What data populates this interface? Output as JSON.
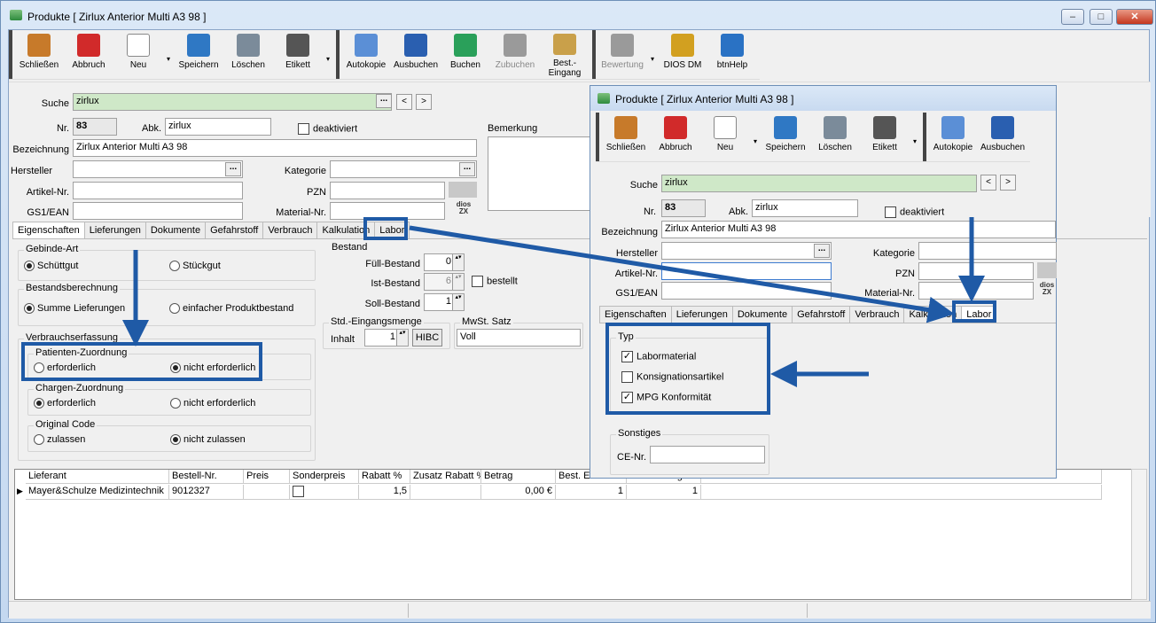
{
  "window": {
    "title": "Produkte [ Zirlux Anterior Multi A3 98 ]",
    "min": "–",
    "max": "□",
    "close": "✕"
  },
  "toolbar": {
    "groups": [
      [
        {
          "label": "Schließen",
          "icon": "door-exit-icon",
          "color": "#c77a2a"
        },
        {
          "label": "Abbruch",
          "icon": "cancel-icon",
          "color": "#d12a2a"
        },
        {
          "label": "Neu",
          "icon": "new-document-icon",
          "color": "#ffffff"
        },
        {
          "label": "Speichern",
          "icon": "save-disk-icon",
          "color": "#2f78c4"
        },
        {
          "label": "Löschen",
          "icon": "trash-icon",
          "color": "#7b8b9a"
        },
        {
          "label": "Etikett",
          "icon": "barcode-printer-icon",
          "color": "#555555"
        }
      ],
      [
        {
          "label": "Autokopie",
          "icon": "copy-icon",
          "color": "#5b8fd6"
        },
        {
          "label": "Ausbuchen",
          "icon": "book-out-icon",
          "color": "#2a5fb0"
        },
        {
          "label": "Buchen",
          "icon": "book-in-icon",
          "color": "#2aa05a"
        },
        {
          "label": "Zubuchen",
          "icon": "book-add-icon",
          "color": "#9a9a9a"
        },
        {
          "label": "Best.-Eingang",
          "icon": "package-icon",
          "color": "#c9a04a"
        }
      ],
      [
        {
          "label": "Bewertung",
          "icon": "rating-chart-icon",
          "color": "#9a9a9a"
        },
        {
          "label": "DIOS DM",
          "icon": "qm-icon",
          "color": "#d2a020"
        },
        {
          "label": "btnHelp",
          "icon": "help-icon",
          "color": "#2a72c4"
        }
      ]
    ],
    "drop": "▾"
  },
  "form": {
    "suche_label": "Suche",
    "suche_value": "zirlux",
    "nr_label": "Nr.",
    "nr_value": "83",
    "abk_label": "Abk.",
    "abk_value": "zirlux",
    "deaktiviert": "deaktiviert",
    "bemerkung": "Bemerkung",
    "bezeichnung_label": "Bezeichnung",
    "bezeichnung_value": "Zirlux Anterior Multi A3 98",
    "hersteller": "Hersteller",
    "kategorie": "Kategorie",
    "artikel_nr": "Artikel-Nr.",
    "pzn": "PZN",
    "gs1": "GS1/EAN",
    "material_nr": "Material-Nr.",
    "dots": "...",
    "prev": "<",
    "next": ">",
    "dios": "dios ZX"
  },
  "tabs": [
    "Eigenschaften",
    "Lieferungen",
    "Dokumente",
    "Gefahrstoff",
    "Verbrauch",
    "Kalkulation",
    "Labor"
  ],
  "eigen": {
    "gebinde": "Gebinde-Art",
    "schuettgut": "Schüttgut",
    "stueckgut": "Stückgut",
    "bestandsberechnung": "Bestandsberechnung",
    "summe": "Summe Lieferungen",
    "einfach": "einfacher Produktbestand",
    "verbrauch": "Verbrauchserfassung",
    "patient": "Patienten-Zuordnung",
    "charge": "Chargen-Zuordnung",
    "original": "Original Code",
    "erforderlich": "erforderlich",
    "nicht_erforderlich": "nicht erforderlich",
    "zulassen": "zulassen",
    "nicht_zulassen": "nicht zulassen",
    "bestand": "Bestand",
    "full": "Füll-Bestand",
    "ist": "Ist-Bestand",
    "soll": "Soll-Bestand",
    "full_v": "0",
    "ist_v": "6",
    "soll_v": "1",
    "bestellt": "bestellt",
    "std": "Std.-Eingangsmenge",
    "inhalt": "Inhalt",
    "inhalt_v": "1",
    "hibc": "HIBC",
    "mwst": "MwSt. Satz",
    "mwst_v": "Voll"
  },
  "grid": {
    "headers": [
      "Lieferant",
      "Bestell-Nr.",
      "Preis",
      "Sonderpreis",
      "Rabatt %",
      "Zusatz Rabatt %",
      "Betrag",
      "Best. Einheiten",
      "Inhaltsmenge",
      "Einheiten"
    ],
    "row": {
      "lieferant": "Mayer&Schulze Medizintechnik",
      "bestell": "9012327",
      "rabatt": "1,5",
      "betrag": "0,00 €",
      "best": "1",
      "inhalt": "1"
    }
  },
  "overlay": {
    "title": "Produkte [ Zirlux Anterior Multi A3 98 ]",
    "toolbar": [
      {
        "label": "Schließen",
        "icon": "door-exit-icon",
        "color": "#c77a2a"
      },
      {
        "label": "Abbruch",
        "icon": "cancel-icon",
        "color": "#d12a2a"
      },
      {
        "label": "Neu",
        "icon": "new-document-icon",
        "color": "#ffffff"
      },
      {
        "label": "Speichern",
        "icon": "save-disk-icon",
        "color": "#2f78c4"
      },
      {
        "label": "Löschen",
        "icon": "trash-icon",
        "color": "#7b8b9a"
      },
      {
        "label": "Etikett",
        "icon": "barcode-printer-icon",
        "color": "#555555"
      }
    ],
    "toolbar2": [
      {
        "label": "Autokopie",
        "icon": "copy-icon",
        "color": "#5b8fd6"
      },
      {
        "label": "Ausbuchen",
        "icon": "book-out-icon",
        "color": "#2a5fb0"
      }
    ],
    "typ": "Typ",
    "labormaterial": "Labormaterial",
    "konsignation": "Konsignationsartikel",
    "mpg": "MPG Konformität",
    "sonstiges": "Sonstiges",
    "ce": "CE-Nr."
  },
  "accent": "#1f5aa6"
}
